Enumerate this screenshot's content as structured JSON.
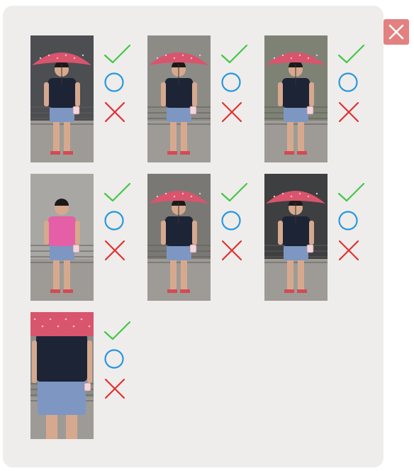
{
  "colors": {
    "panel_bg": "#eeedec",
    "close_bg": "#e38080",
    "check": "#44c744",
    "circle": "#2a97de",
    "cross": "#e0322f",
    "umbrella": "#d9546d",
    "shirt_dark": "#1d2436",
    "shirt_pink": "#e55fa6",
    "shorts": "#7d97c2"
  },
  "icons": {
    "close": "close-icon",
    "accept": "check-icon",
    "uncertain": "circle-icon",
    "reject": "cross-icon"
  },
  "images": [
    {
      "subject": "woman-with-pink-umbrella",
      "umbrella": true,
      "shirt": "dark"
    },
    {
      "subject": "woman-with-pink-umbrella",
      "umbrella": true,
      "shirt": "dark"
    },
    {
      "subject": "woman-with-pink-umbrella",
      "umbrella": true,
      "shirt": "dark"
    },
    {
      "subject": "woman-in-pink-shirt",
      "umbrella": false,
      "shirt": "pink"
    },
    {
      "subject": "woman-with-pink-umbrella",
      "umbrella": true,
      "shirt": "dark"
    },
    {
      "subject": "woman-with-pink-umbrella",
      "umbrella": true,
      "shirt": "dark"
    },
    {
      "subject": "woman-with-pink-umbrella-closeup",
      "umbrella": true,
      "shirt": "dark"
    }
  ]
}
